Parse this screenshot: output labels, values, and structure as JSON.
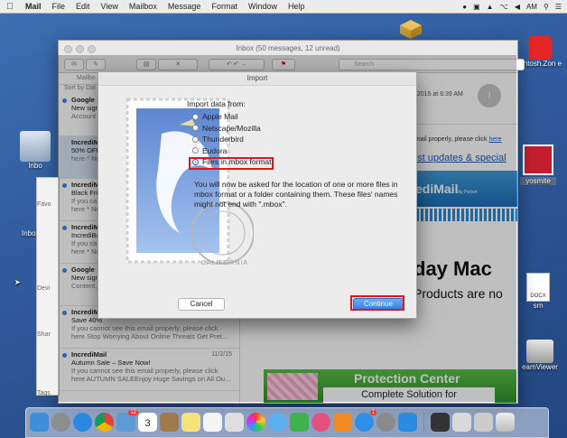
{
  "menubar": {
    "app": "Mail",
    "items": [
      "File",
      "Edit",
      "View",
      "Mailbox",
      "Message",
      "Format",
      "Window",
      "Help"
    ],
    "clock": "AM"
  },
  "desktop": {
    "icons": [
      {
        "label": "kintosh.Zon e"
      },
      {
        "label": "yosmite"
      },
      {
        "label": "DOCX"
      },
      {
        "label": "srn"
      },
      {
        "label": "eamViewer"
      }
    ],
    "left_labels": [
      "Inbo",
      "Inbo"
    ]
  },
  "mail": {
    "title": "Inbox (50 messages, 12 unread)",
    "search_placeholder": "Search",
    "sidebar_header": "Mailbo",
    "sort_label": "Sort by Dat",
    "sidebar_sections": [
      "Favo",
      "Devi",
      "Shar",
      "Tags"
    ],
    "messages": [
      {
        "from": "Google",
        "line1": "New sign",
        "line2": "Account"
      },
      {
        "from": "IncrediM",
        "line1": "50% OFF",
        "line2": "here * No"
      },
      {
        "from": "IncrediM",
        "line1": "Black Fri",
        "line2": "If you ca",
        "line3": "here * No"
      },
      {
        "from": "IncrediM",
        "line1": "IncrediBa",
        "line2": "If you ca",
        "line3": "here * No"
      },
      {
        "from": "Google",
        "line1": "New sign",
        "line2": "Content,"
      },
      {
        "from": "IncrediM",
        "line1": "Save 40%",
        "line2": "If you cannot see this email properly, please click",
        "line3": "here Stop Worrying About Online Threats Get Pret..."
      },
      {
        "from": "IncrediMail",
        "date": "11/2/15",
        "line1": "Autumn Sale – Save Now!",
        "line2": "If you cannot see this email properly, please click",
        "line3": "here AUTUMN SALEEnjoy Huge Savings on All Ou..."
      }
    ],
    "preview": {
      "date": ", 2015 at 6:39 AM",
      "avatar": "I",
      "line1": "email properly, please click",
      "here": "here",
      "latest": "est updates & special",
      "brand": "ediMail",
      "brand_suffix": "by Perion",
      "big1": "day Mac",
      "big2": "Products are no",
      "protection_title": "Protection Center",
      "protection_sub": "Complete Solution for"
    }
  },
  "dialog": {
    "title": "Import",
    "import_label": "Import data from:",
    "options": [
      {
        "label": "Apple Mail",
        "selected": false
      },
      {
        "label": "Netscape/Mozilla",
        "selected": false
      },
      {
        "label": "Thunderbird",
        "selected": false
      },
      {
        "label": "Eudora",
        "selected": false
      },
      {
        "label": "Files in mbox format",
        "selected": true
      }
    ],
    "description": "You will now be asked for the location of one or more files in mbox format or a folder containing them. These files' names might not end with \".mbox\".",
    "stamp_text": "CALIFORNIA",
    "cancel": "Cancel",
    "continue": "Continue"
  },
  "dock": {
    "calendar_day": "3",
    "badges": [
      "12",
      "1"
    ]
  }
}
